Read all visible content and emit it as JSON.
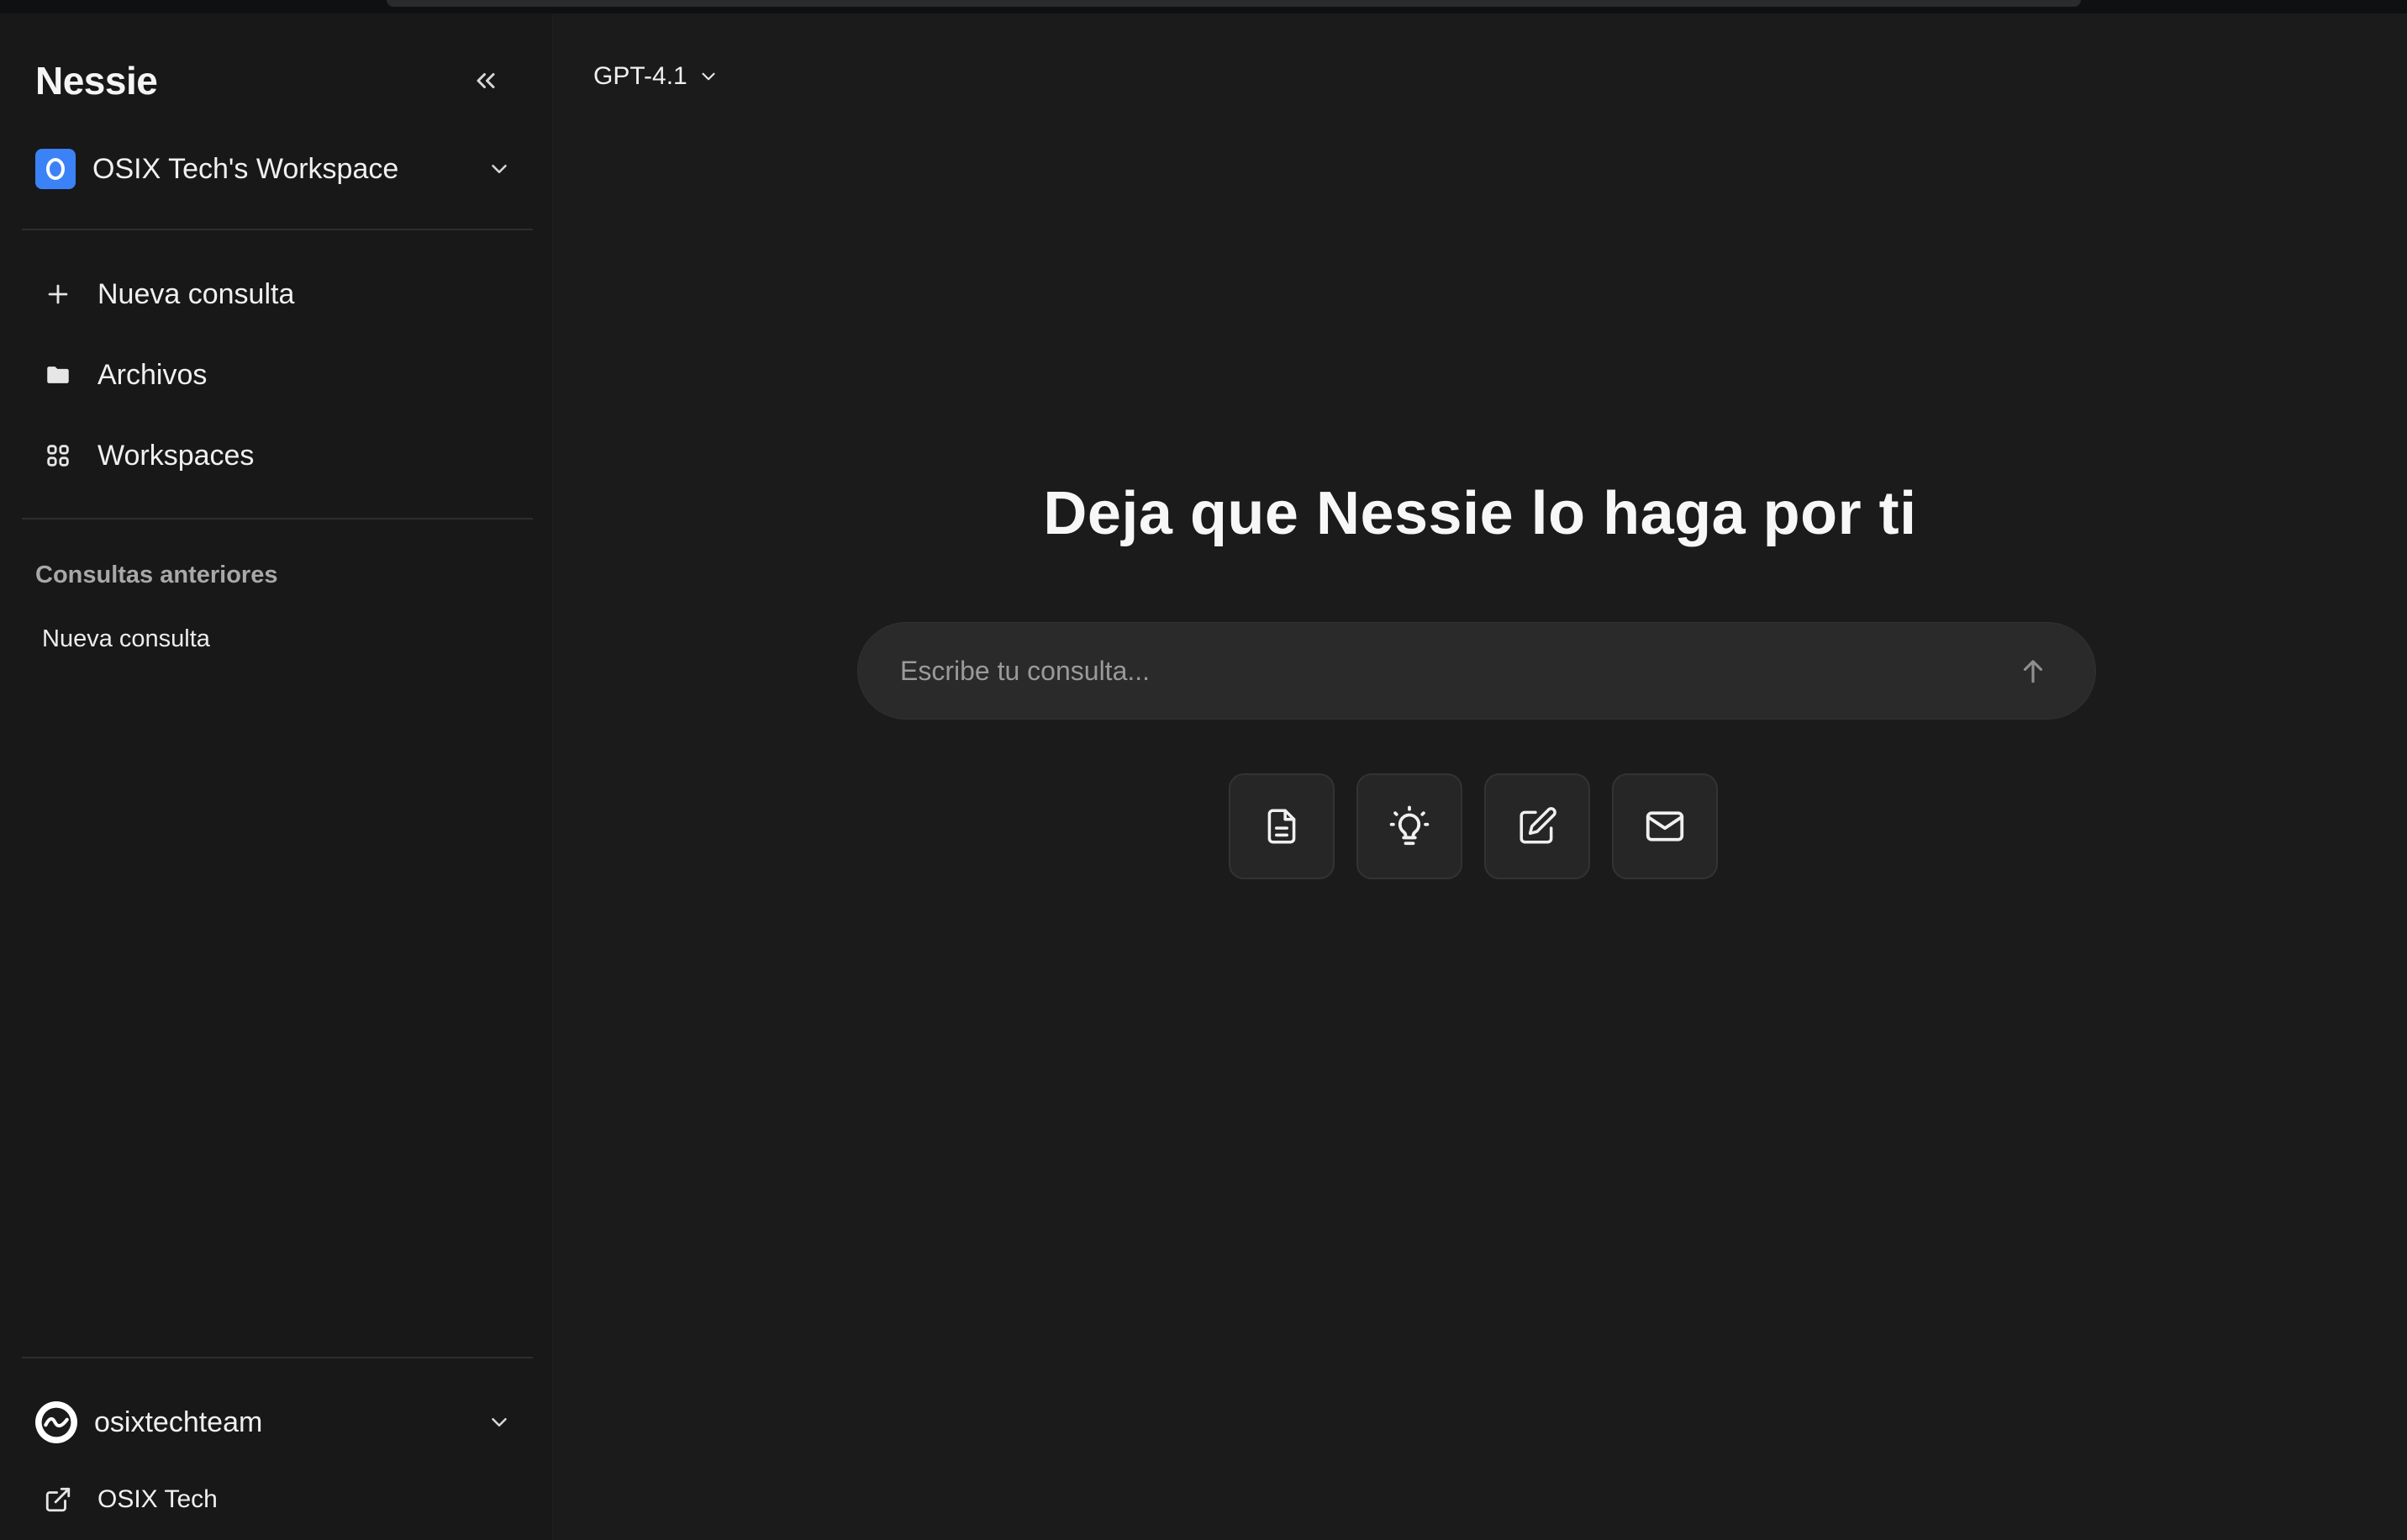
{
  "sidebar": {
    "brand": "Nessie",
    "workspace": {
      "name": "OSIX Tech's Workspace",
      "badge_color": "#3b82f6"
    },
    "nav": [
      {
        "label": "Nueva consulta",
        "icon": "plus-icon"
      },
      {
        "label": "Archivos",
        "icon": "folder-icon"
      },
      {
        "label": "Workspaces",
        "icon": "grid-icon"
      }
    ],
    "history_title": "Consultas anteriores",
    "history": [
      {
        "label": "Nueva consulta"
      }
    ],
    "user": {
      "name": "osixtechteam"
    },
    "external_link": {
      "label": "OSIX Tech",
      "icon": "external-link-icon"
    }
  },
  "main": {
    "model": "GPT-4.1",
    "hero": "Deja que Nessie lo haga por ti",
    "query": {
      "placeholder": "Escribe tu consulta...",
      "value": ""
    },
    "actions": [
      {
        "icon": "document-icon"
      },
      {
        "icon": "lightbulb-icon"
      },
      {
        "icon": "edit-icon"
      },
      {
        "icon": "mail-icon"
      }
    ]
  }
}
